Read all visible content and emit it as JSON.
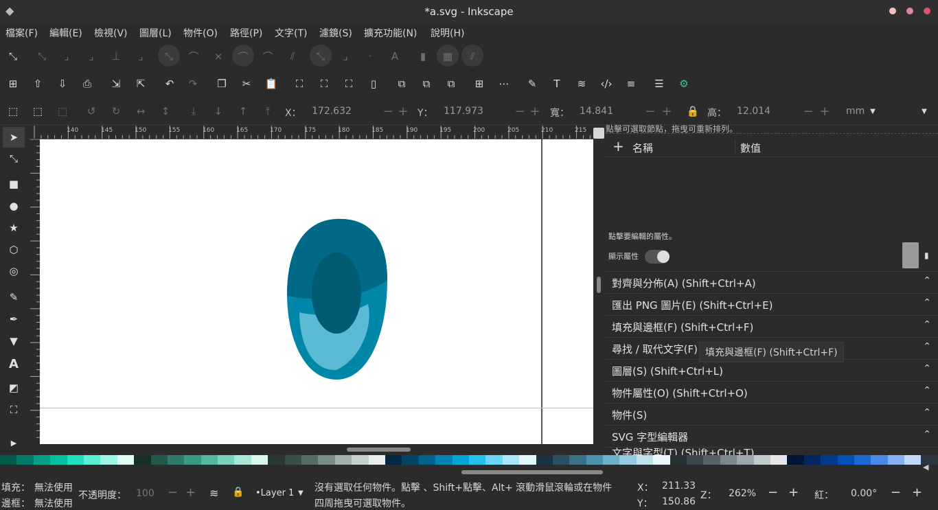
{
  "window": {
    "title": "*a.svg - Inkscape",
    "controls": [
      {
        "name": "minimize",
        "color": "#f5c2c2"
      },
      {
        "name": "maximize",
        "color": "#d98a9a"
      },
      {
        "name": "close",
        "color": "#d6546d"
      }
    ]
  },
  "menu": [
    "檔案(F)",
    "編輯(E)",
    "檢視(V)",
    "圖層(L)",
    "物件(O)",
    "路徑(P)",
    "文字(T)",
    "濾鏡(S)",
    "擴充功能(N)",
    "說明(H)"
  ],
  "toolbar": {
    "icons": [
      "new-icon",
      "import-icon",
      "export-icon",
      "print-icon",
      "import-doc-icon",
      "export-doc-icon",
      "undo-icon",
      "redo-icon",
      "copy-icon",
      "cut-icon",
      "paste-icon",
      "zoom-selection-icon",
      "zoom-drawing-icon",
      "zoom-page-icon",
      "color-swatch-icon",
      "duplicate-icon",
      "clone-icon",
      "unlink-clone-icon",
      "group-icon",
      "ungroup-icon",
      "fill-stroke-icon",
      "text-icon",
      "layers-icon",
      "xml-editor-icon",
      "align-icon",
      "objects-icon",
      "preferences-icon"
    ]
  },
  "selectbar": {
    "x_label": "X：",
    "x_value": "172.632",
    "y_label": "Y：",
    "y_value": "117.973",
    "w_label": "寬：",
    "w_value": "14.841",
    "h_label": "高：",
    "h_value": "12.014",
    "unit": "mm"
  },
  "ruler": {
    "ticks": [
      "140",
      "145",
      "150",
      "155",
      "160",
      "165",
      "170",
      "175",
      "180",
      "185",
      "190",
      "195",
      "200",
      "205",
      "210",
      "215"
    ]
  },
  "canvas": {
    "shapes": {
      "outer": "#0086a8",
      "top": "#006a86",
      "light": "#5bbad4",
      "inner": "#005a72"
    }
  },
  "tools": [
    "selector-icon",
    "node-icon",
    "rect-icon",
    "circle-icon",
    "star-icon",
    "3dbox-icon",
    "spiral-icon",
    "pencil-icon",
    "pen-icon",
    "calligraphy-icon",
    "text-tool-icon",
    "gradient-icon",
    "zoom-icon"
  ],
  "attributes_panel": {
    "hint_top": "點擊可選取節點，拖曳可重新排列。",
    "col_name": "名稱",
    "col_value": "數值",
    "hint_click": "點擊要編輯的屬性。",
    "show_attrs": "顯示屬性"
  },
  "docks": [
    "對齊與分佈(A) (Shift+Ctrl+A)",
    "匯出 PNG 圖片(E) (Shift+Ctrl+E)",
    "填充與邊框(F) (Shift+Ctrl+F)",
    "尋找 / 取代文字(F) (Ctrl+F)",
    "圖層(S) (Shift+Ctrl+L)",
    "物件屬性(O) (Shift+Ctrl+O)",
    "物件(S)",
    "SVG 字型編輯器",
    "文字與字型(T) (Shift+Ctrl+T)"
  ],
  "tooltip": "填充與邊框(F) (Shift+Ctrl+F)",
  "palette": [
    "#005a4c",
    "#007a66",
    "#00a086",
    "#00c2a2",
    "#1de0bc",
    "#5cf0d2",
    "#9ef6e4",
    "#e0fcf6",
    "#1a2e2a",
    "#24584c",
    "#2f7a6a",
    "#3a9a86",
    "#52b8a2",
    "#7ad2be",
    "#a8e6d8",
    "#d6f6ee",
    "#283634",
    "#3a4e4a",
    "#566a66",
    "#788c88",
    "#a0b0ac",
    "#c6d2d0",
    "#e8eeee",
    "#002a44",
    "#004466",
    "#00628a",
    "#0084b2",
    "#00a6d8",
    "#26c2ee",
    "#6cd6f6",
    "#a8e8fa",
    "#e0f8fe",
    "#1c3442",
    "#2a5064",
    "#3a7088",
    "#4c92ae",
    "#6cb0ca",
    "#96cade",
    "#c2e2ee",
    "#eaf6fa",
    "#2a3236",
    "#3c484e",
    "#56646a",
    "#788890",
    "#9ca8ae",
    "#c2cace",
    "#e4e8ea",
    "#001438",
    "#002660",
    "#003a8a",
    "#0050b6",
    "#1a6ad6",
    "#4a8ae8",
    "#86b0f2",
    "#c2d8fa",
    "#2c3440"
  ],
  "status": {
    "fill_label": "填充：",
    "fill_value": "無法使用",
    "stroke_label": "邊框：",
    "stroke_value": "無法使用",
    "opacity_label": "不透明度：",
    "opacity_value": "100",
    "layer": "•Layer 1",
    "message_line1": "沒有選取任何物件。點擊 、Shift+點擊、Alt+ 滾動滑鼠滾輪或在物件",
    "message_line2": "四周拖曳可選取物件。",
    "x_label": "X：",
    "x_value": "211.33",
    "y_label": "Y：",
    "y_value": "150.86",
    "z_label": "Z：",
    "zoom": "262%",
    "r_label": "紅：",
    "rotation": "0.00°"
  }
}
